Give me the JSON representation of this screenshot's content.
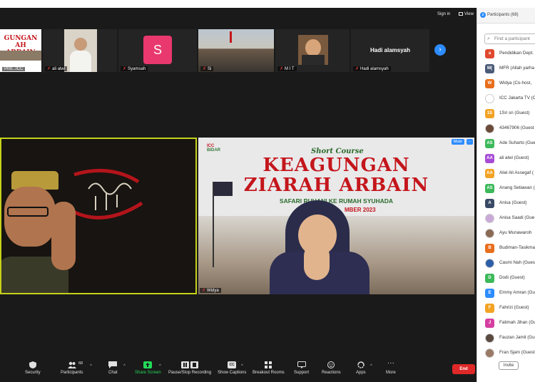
{
  "window": {
    "signin_label": "Sign in",
    "view_label": "View"
  },
  "thumbnails": [
    {
      "name": "Prot...ICC",
      "banner_text": [
        "GUNGAN",
        "AH ARBAIN"
      ]
    },
    {
      "name": "ali alwi"
    },
    {
      "name": "Syamsah",
      "avatar_letter": "S",
      "avatar_color": "#e8386d"
    },
    {
      "name": "Si"
    },
    {
      "name": "M I T"
    },
    {
      "name": "Hadi alamsyah",
      "center_name": "Hadi alamsyah"
    }
  ],
  "thumbnails_next_icon": "chevron-right-icon",
  "stage": {
    "left_tile": {
      "active_speaker": true,
      "border_color": "#c5d21a"
    },
    "right_tile": {
      "name": "Widya",
      "mute_label": "Mute",
      "more_label": "···",
      "slide": {
        "org": "ICC",
        "logo_text": "BIDAR",
        "kicker": "Short Course",
        "title_line1": "KEAGUNGAN",
        "title_line2": "ZIARAH ARBAIN",
        "subtitle": "SAFARI RUHANI KE RUMAH SYUHADA",
        "date": "MBER 2023"
      }
    }
  },
  "toolbar": {
    "items": [
      {
        "label": "Security",
        "icon": "shield-icon"
      },
      {
        "label": "Participants",
        "icon": "people-icon",
        "badge": "68"
      },
      {
        "label": "Chat",
        "icon": "chat-icon"
      },
      {
        "label": "Share Screen",
        "icon": "share-screen-icon"
      },
      {
        "label": "Pause/Stop Recording",
        "icon": "pause-recording-icon"
      },
      {
        "label": "Show Captions",
        "icon": "cc-icon",
        "icon_text": "CC"
      },
      {
        "label": "Breakout Rooms",
        "icon": "breakout-rooms-icon"
      },
      {
        "label": "Support",
        "icon": "support-icon"
      },
      {
        "label": "Reactions",
        "icon": "reactions-icon"
      },
      {
        "label": "Apps",
        "icon": "apps-icon"
      },
      {
        "label": "More",
        "icon": "more-icon"
      }
    ],
    "end_label": "End",
    "accent_green": "#23d959",
    "end_color": "#e02828"
  },
  "participants_panel": {
    "title": "Participants (68)",
    "search_placeholder": "Find a participant",
    "invite_label": "Invite",
    "participants": [
      {
        "initials": "a",
        "color": "#e0492f",
        "name": "Pendidikan Dept."
      },
      {
        "initials": "M(",
        "color": "#4a5b78",
        "name": "MFR (Allah yarha"
      },
      {
        "initials": "W",
        "color": "#e86e1c",
        "name": "Widya (Co-host,"
      },
      {
        "initials": "",
        "color": "#ffffff",
        "name": "ICC Jakarta TV (C",
        "photo": true
      },
      {
        "initials": "1S",
        "color": "#f2a324",
        "name": "1Sri sri (Guest)"
      },
      {
        "initials": "",
        "color": "#6b4a3a",
        "name": "43467906 (Guest",
        "photo": true
      },
      {
        "initials": "AS",
        "color": "#3cb95a",
        "name": "Ade Suharto (Gue"
      },
      {
        "initials": "AA",
        "color": "#a64bd6",
        "name": "ali alwi (Guest)"
      },
      {
        "initials": "AA",
        "color": "#f2a324",
        "name": "Alwi Ali Assegaf ("
      },
      {
        "initials": "AS",
        "color": "#3cb95a",
        "name": "Anang Setiawan ("
      },
      {
        "initials": "A",
        "color": "#3a4a66",
        "name": "Anisa (Guest)"
      },
      {
        "initials": "",
        "color": "#c9a9d8",
        "name": "Anisa Saadi (Gue",
        "photo": true
      },
      {
        "initials": "",
        "color": "#8a6a55",
        "name": "Ayu Munawaroh",
        "photo": true
      },
      {
        "initials": "B",
        "color": "#e86e1c",
        "name": "Budiman-Tasikma"
      },
      {
        "initials": "",
        "color": "#2d5fa8",
        "name": "Casmi Nah (Gues",
        "photo": true
      },
      {
        "initials": "D",
        "color": "#3cb95a",
        "name": "Dodi (Guest)"
      },
      {
        "initials": "E",
        "color": "#2d8cff",
        "name": "Emmy Amran (Gu"
      },
      {
        "initials": "F",
        "color": "#f2a324",
        "name": "Fahrizi (Guest)"
      },
      {
        "initials": "J",
        "color": "#d63ea0",
        "name": "Fatimah Jihan (Gu"
      },
      {
        "initials": "",
        "color": "#5a4a40",
        "name": "Fauzan Jamil (Gu",
        "photo": true
      },
      {
        "initials": "",
        "color": "#9a7a66",
        "name": "Fran Sjam (Guest",
        "photo": true
      }
    ]
  }
}
